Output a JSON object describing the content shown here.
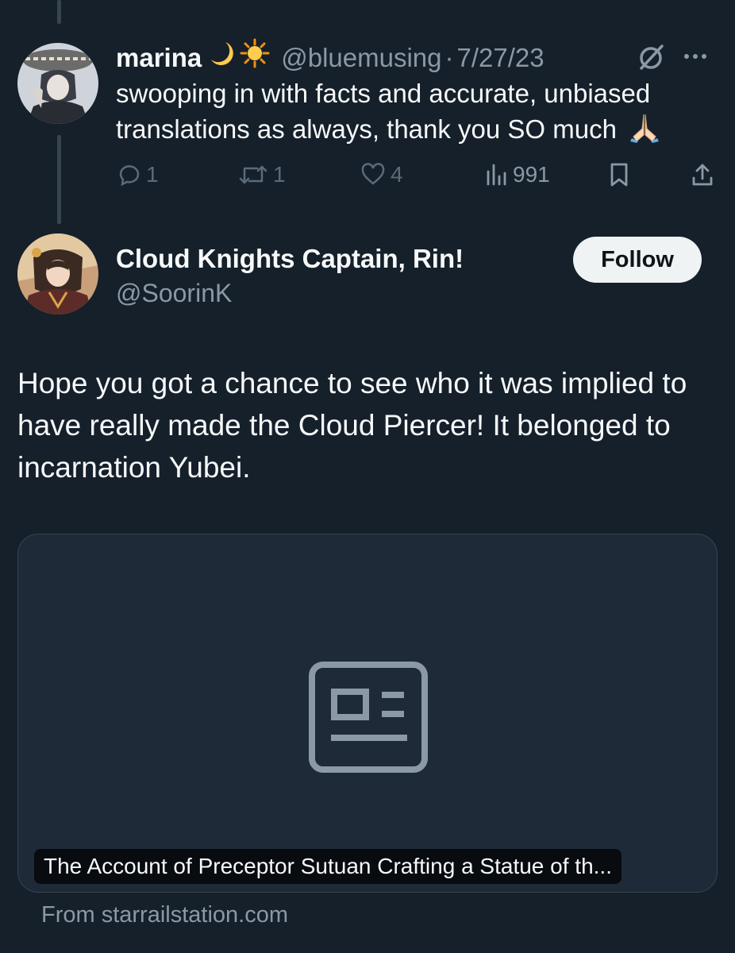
{
  "reply": {
    "name": "marina",
    "emojis": [
      "crescent-moon-icon",
      "sun-icon",
      "pray-hands-icon"
    ],
    "handle": "@bluemusing",
    "separator": "·",
    "date": "7/27/23",
    "text": "swooping in with facts and accurate, unbiased translations as always, thank you SO much",
    "actions": {
      "replies": "1",
      "reposts": "1",
      "likes": "4",
      "views": "991"
    }
  },
  "tweet": {
    "author_name": "Cloud Knights Captain, Rin!",
    "author_handle": "@SoorinK",
    "follow_label": "Follow",
    "text": "Hope you got a chance to see who it was implied to have really made the Cloud Piercer! It belonged to incarnation Yubei.",
    "card": {
      "title": "The Account of Preceptor Sutuan Crafting a Statue of th...",
      "source": "From starrailstation.com"
    }
  },
  "colors": {
    "background": "#15202b",
    "text_primary": "#f7f9f9",
    "text_secondary": "#8b98a5",
    "card_bg": "#1e2a38",
    "follow_bg": "#eff3f4"
  }
}
